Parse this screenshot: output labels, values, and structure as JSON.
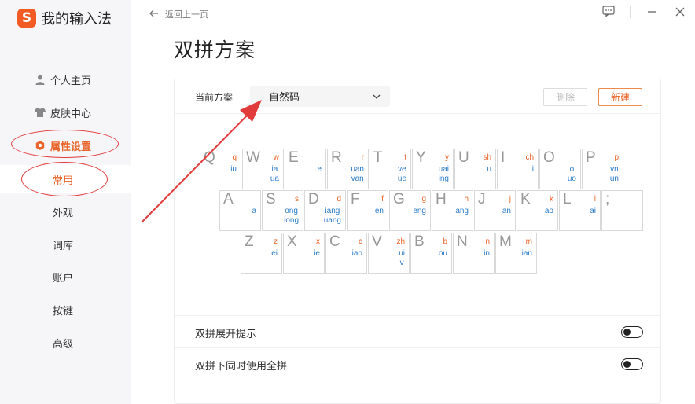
{
  "brand": {
    "title": "我的输入法",
    "logo_glyph": "S",
    "accent": "#f25c24"
  },
  "sidebar": {
    "items": [
      {
        "label": "个人主页",
        "icon": "user-icon"
      },
      {
        "label": "皮肤中心",
        "icon": "shirt-icon"
      },
      {
        "label": "属性设置",
        "icon": "settings-gear-icon",
        "active": true
      },
      {
        "label": "常用",
        "active": true
      },
      {
        "label": "外观"
      },
      {
        "label": "词库"
      },
      {
        "label": "账户"
      },
      {
        "label": "按键"
      },
      {
        "label": "高级"
      }
    ]
  },
  "topbar": {
    "back_label": "返回上一页"
  },
  "page": {
    "title": "双拼方案"
  },
  "scheme": {
    "label": "当前方案",
    "selected": "自然码",
    "delete_label": "删除",
    "new_label": "新建"
  },
  "keyboard": {
    "rows": [
      [
        {
          "k": "Q",
          "i": "q",
          "f": [
            "iu"
          ]
        },
        {
          "k": "W",
          "i": "w",
          "f": [
            "ia",
            "ua"
          ]
        },
        {
          "k": "E",
          "i": "",
          "f": [
            "e"
          ]
        },
        {
          "k": "R",
          "i": "r",
          "f": [
            "uan",
            "van"
          ]
        },
        {
          "k": "T",
          "i": "t",
          "f": [
            "ve",
            "ue"
          ]
        },
        {
          "k": "Y",
          "i": "y",
          "f": [
            "uai",
            "ing"
          ]
        },
        {
          "k": "U",
          "i": "sh",
          "f": [
            "u"
          ]
        },
        {
          "k": "I",
          "i": "ch",
          "f": [
            "i"
          ]
        },
        {
          "k": "O",
          "i": "",
          "f": [
            "o",
            "uo"
          ]
        },
        {
          "k": "P",
          "i": "p",
          "f": [
            "vn",
            "un"
          ]
        }
      ],
      [
        {
          "k": "A",
          "i": "",
          "f": [
            "a"
          ]
        },
        {
          "k": "S",
          "i": "s",
          "f": [
            "ong",
            "iong"
          ]
        },
        {
          "k": "D",
          "i": "d",
          "f": [
            "iang",
            "uang"
          ]
        },
        {
          "k": "F",
          "i": "f",
          "f": [
            "en"
          ]
        },
        {
          "k": "G",
          "i": "g",
          "f": [
            "eng"
          ]
        },
        {
          "k": "H",
          "i": "h",
          "f": [
            "ang"
          ]
        },
        {
          "k": "J",
          "i": "j",
          "f": [
            "an"
          ]
        },
        {
          "k": "K",
          "i": "k",
          "f": [
            "ao"
          ]
        },
        {
          "k": "L",
          "i": "l",
          "f": [
            "ai"
          ]
        },
        {
          "k": ";",
          "i": "",
          "f": []
        }
      ],
      [
        {
          "k": "Z",
          "i": "z",
          "f": [
            "ei"
          ]
        },
        {
          "k": "X",
          "i": "x",
          "f": [
            "ie"
          ]
        },
        {
          "k": "C",
          "i": "c",
          "f": [
            "iao"
          ]
        },
        {
          "k": "V",
          "i": "zh",
          "f": [
            "ui",
            "v"
          ]
        },
        {
          "k": "B",
          "i": "b",
          "f": [
            "ou"
          ]
        },
        {
          "k": "N",
          "i": "n",
          "f": [
            "in"
          ]
        },
        {
          "k": "M",
          "i": "m",
          "f": [
            "ian"
          ]
        }
      ]
    ]
  },
  "options": [
    {
      "label": "双拼展开提示",
      "on": false
    },
    {
      "label": "双拼下同时使用全拼",
      "on": false
    }
  ],
  "colors": {
    "accent": "#e8642a",
    "initial": "#e8642a",
    "final": "#2a7bc8",
    "annotation": "#e23b3b"
  }
}
